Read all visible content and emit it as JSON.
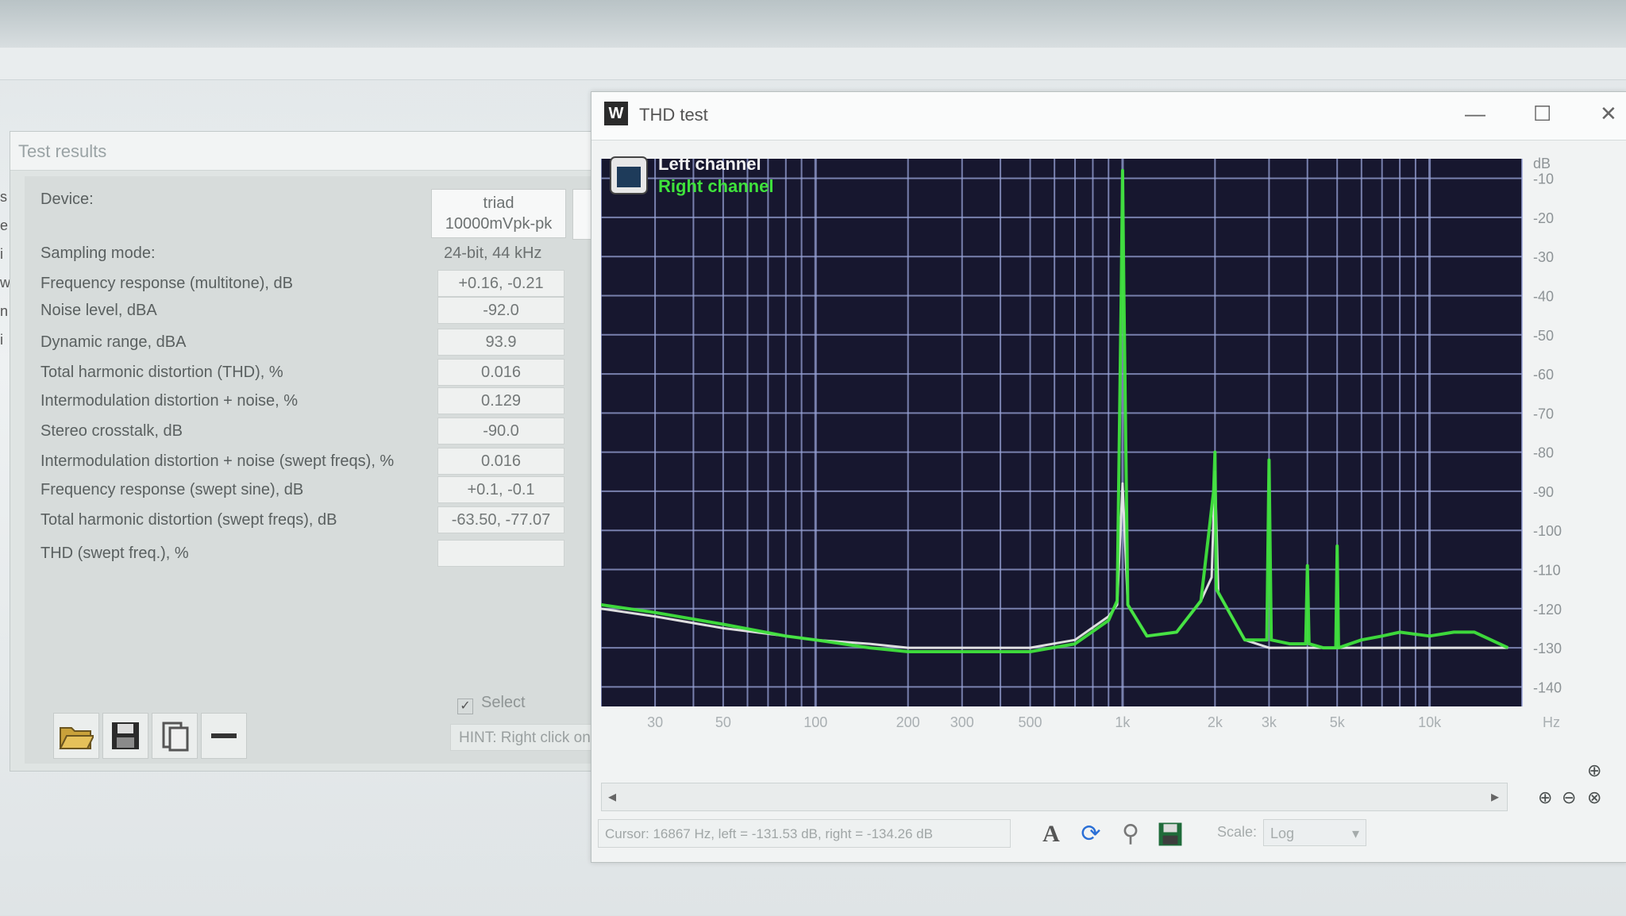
{
  "results": {
    "title": "Test results",
    "device_label": "Device:",
    "device_value_line1": "triad",
    "device_value_line2": "10000mVpk-pk",
    "rows": [
      {
        "label": "Sampling mode:",
        "value": "24-bit, 44 kHz",
        "boxed": false
      },
      {
        "label": "Frequency response (multitone), dB",
        "value": "+0.16, -0.21",
        "boxed": true
      },
      {
        "label": "Noise level, dBA",
        "value": "-92.0",
        "boxed": true
      },
      {
        "label": "Dynamic range, dBA",
        "value": "93.9",
        "boxed": true
      },
      {
        "label": "Total harmonic distortion (THD), %",
        "value": "0.016",
        "boxed": true
      },
      {
        "label": "Intermodulation distortion + noise, %",
        "value": "0.129",
        "boxed": true
      },
      {
        "label": "Stereo crosstalk, dB",
        "value": "-90.0",
        "boxed": true
      },
      {
        "label": "Intermodulation distortion + noise (swept freqs), %",
        "value": "0.016",
        "boxed": true
      },
      {
        "label": "Frequency response (swept sine), dB",
        "value": "+0.1, -0.1",
        "boxed": true
      },
      {
        "label": "Total harmonic distortion (swept freqs), dB",
        "value": "-63.50, -77.07",
        "boxed": true
      },
      {
        "label": "THD (swept freq.), %",
        "value": "",
        "boxed": true
      }
    ],
    "select_label": "Select",
    "hint": "HINT: Right click on",
    "tool_icons": [
      "open-folder-icon",
      "save-icon",
      "copy-icon",
      "remove-icon"
    ]
  },
  "thd": {
    "title": "THD test",
    "status_cursor": "Cursor: 16867 Hz, left = -131.53 dB, right = -134.26 dB",
    "scale_label": "Scale:",
    "scale_value": "Log"
  },
  "chart_data": {
    "type": "line",
    "legend": [
      "Left channel",
      "Right channel"
    ],
    "legend_placement": "top-left",
    "ylabel": "dB",
    "xlabel": "Hz",
    "x_scale": "log",
    "xlim": [
      20,
      20000
    ],
    "ylim": [
      -145,
      -5
    ],
    "x_ticks": [
      30,
      50,
      100,
      200,
      300,
      500,
      1000,
      2000,
      3000,
      5000,
      10000
    ],
    "x_tick_labels": [
      "30",
      "50",
      "100",
      "200",
      "300",
      "500",
      "1k",
      "2k",
      "3k",
      "5k",
      "10k"
    ],
    "y_ticks": [
      -10,
      -20,
      -30,
      -40,
      -50,
      -60,
      -70,
      -80,
      -90,
      -100,
      -110,
      -120,
      -130,
      -140
    ],
    "y_tick_labels": [
      "-10",
      "-20",
      "-30",
      "-40",
      "-50",
      "-60",
      "-70",
      "-80",
      "-90",
      "-100",
      "-110",
      "-120",
      "-130",
      "-140"
    ],
    "grid": true,
    "background": "#17172f",
    "series": [
      {
        "name": "Left channel",
        "color": "#e9e9e9",
        "x": [
          20,
          30,
          50,
          80,
          100,
          150,
          200,
          300,
          500,
          700,
          900,
          960,
          1000,
          1040,
          1200,
          1500,
          1800,
          1950,
          2000,
          2050,
          2500,
          3000,
          5000,
          8000,
          12000,
          18000
        ],
        "y": [
          -120,
          -122,
          -125,
          -127,
          -128,
          -129,
          -130,
          -130,
          -130,
          -128,
          -122,
          -119,
          -88,
          -119,
          -127,
          -126,
          -118,
          -112,
          -85,
          -116,
          -128,
          -130,
          -130,
          -130,
          -130,
          -130
        ]
      },
      {
        "name": "Right channel",
        "color": "#3fe23c",
        "x": [
          20,
          30,
          50,
          80,
          100,
          150,
          200,
          300,
          500,
          700,
          900,
          960,
          990,
          1000,
          1010,
          1040,
          1200,
          1500,
          1800,
          1980,
          2000,
          2020,
          2500,
          2950,
          3000,
          3050,
          3500,
          3950,
          4000,
          4050,
          4500,
          4950,
          5000,
          5050,
          6000,
          7000,
          8000,
          10000,
          12000,
          14000,
          18000
        ],
        "y": [
          -119,
          -121,
          -124,
          -127,
          -128,
          -130,
          -131,
          -131,
          -131,
          -129,
          -123,
          -118,
          -40,
          -8,
          -40,
          -119,
          -127,
          -126,
          -118,
          -90,
          -80,
          -115,
          -128,
          -128,
          -82,
          -128,
          -129,
          -129,
          -109,
          -129,
          -130,
          -130,
          -104,
          -130,
          -128,
          -127,
          -126,
          -127,
          -126,
          -126,
          -130
        ]
      }
    ]
  }
}
